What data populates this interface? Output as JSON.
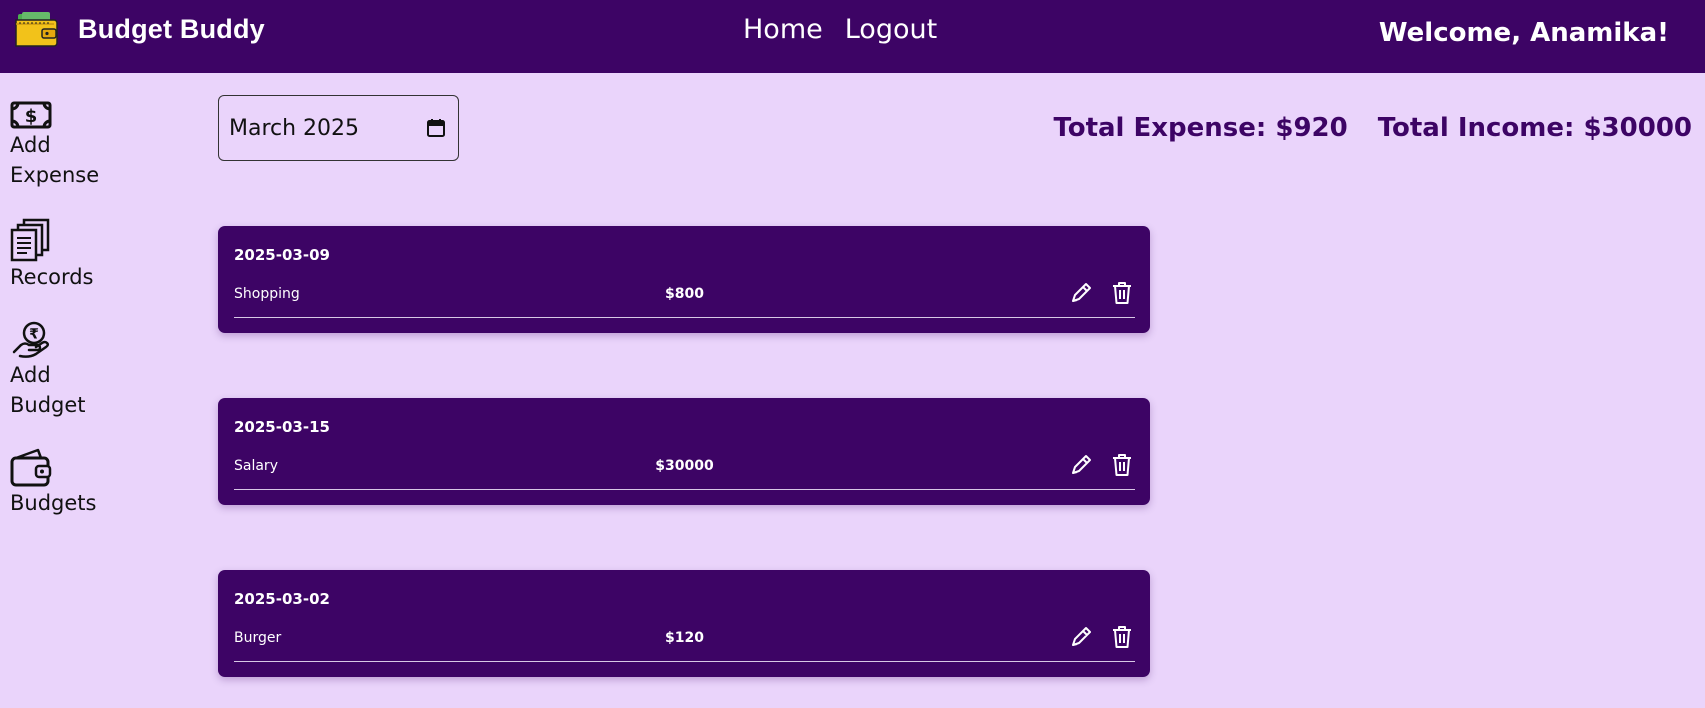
{
  "app": {
    "title": "Budget Buddy"
  },
  "nav": {
    "home": "Home",
    "logout": "Logout"
  },
  "user": {
    "welcome": "Welcome, Anamika!"
  },
  "sidebar": {
    "items": [
      {
        "icon": "money-icon",
        "line1": "Add",
        "line2": "Expense"
      },
      {
        "icon": "documents-icon",
        "line1": "Records",
        "line2": ""
      },
      {
        "icon": "rupee-hand-icon",
        "line1": "Add",
        "line2": "Budget"
      },
      {
        "icon": "wallet-icon",
        "line1": "Budgets",
        "line2": ""
      }
    ]
  },
  "filter": {
    "month": "March 2025"
  },
  "totals": {
    "expense": "Total Expense: $920",
    "income": "Total Income: $30000"
  },
  "records": [
    {
      "date": "2025-03-09",
      "category": "Shopping",
      "amount": "$800"
    },
    {
      "date": "2025-03-15",
      "category": "Salary",
      "amount": "$30000"
    },
    {
      "date": "2025-03-02",
      "category": "Burger",
      "amount": "$120"
    }
  ],
  "colors": {
    "primary": "#3d0465",
    "background": "#ead4fb",
    "text_on_primary": "#ffffff"
  }
}
